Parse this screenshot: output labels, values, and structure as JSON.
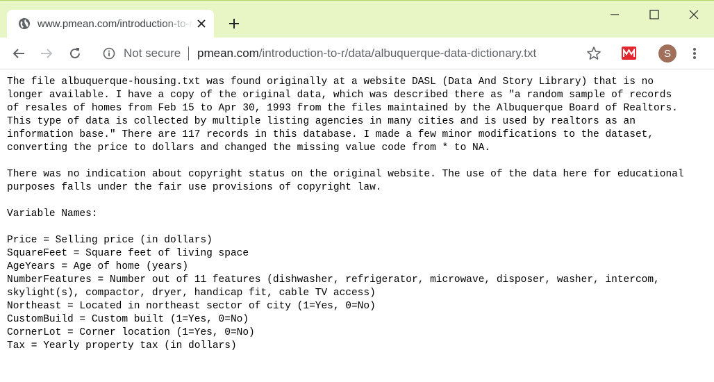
{
  "browser": {
    "tab_title": "www.pmean.com/introduction-to-r/data/albuquerque-data-dictionary.txt",
    "security_label": "Not secure",
    "url_host": "pmean.com",
    "url_path": "/introduction-to-r/data/albuquerque-data-dictionary.txt",
    "avatar_letter": "S",
    "accent_color": "#e8f5c5"
  },
  "icons": [
    "globe-icon",
    "close-icon",
    "plus-icon",
    "minimize-icon",
    "maximize-icon",
    "window-close-icon",
    "back-arrow-icon",
    "forward-arrow-icon",
    "reload-icon",
    "info-icon",
    "star-icon",
    "extension-icon",
    "more-vert-icon"
  ],
  "document": {
    "lines": [
      "The file albuquerque-housing.txt was found originally at a website DASL (Data And Story Library) that is no",
      "longer available. I have a copy of the original data, which was described there as \"a random sample of records",
      "of resales of homes from Feb 15 to Apr 30, 1993 from the files maintained by the Albuquerque Board of Realtors.",
      "This type of data is collected by multiple listing agencies in many cities and is used by realtors as an",
      "information base.\" There are 117 records in this database. I made a few minor modifications to the dataset,",
      "converting the price to dollars and changed the missing value code from * to NA.",
      "",
      "There was no indication about copyright status on the original website. The use of the data here for educational",
      "purposes falls under the fair use provisions of copyright law.",
      "",
      "Variable Names:",
      "",
      "Price = Selling price (in dollars)",
      "SquareFeet = Square feet of living space",
      "AgeYears = Age of home (years)",
      "NumberFeatures = Number out of 11 features (dishwasher, refrigerator, microwave, disposer, washer, intercom,",
      "skylight(s), compactor, dryer, handicap fit, cable TV access)",
      "Northeast = Located in northeast sector of city (1=Yes, 0=No)",
      "CustomBuild = Custom built (1=Yes, 0=No)",
      "CornerLot = Corner location (1=Yes, 0=No)",
      "Tax = Yearly property tax (in dollars)"
    ]
  }
}
